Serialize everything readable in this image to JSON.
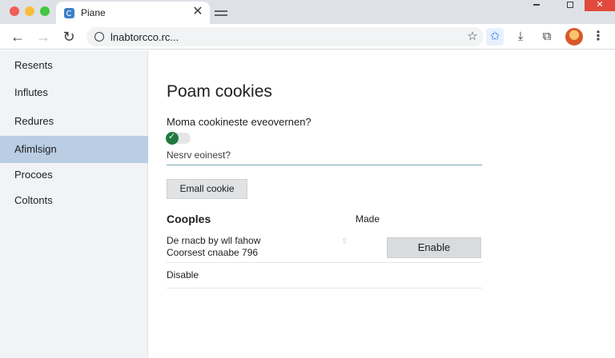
{
  "window": {
    "tab_title": "Piane",
    "tab_close_glyph": "✕",
    "close_glyph": "✕"
  },
  "toolbar": {
    "url": "lnabtorcco.rc..."
  },
  "sidebar": {
    "items": [
      {
        "label": "Resents",
        "active": false
      },
      {
        "label": "Influtes",
        "active": false
      },
      {
        "label": "Redures",
        "active": false
      },
      {
        "label": "Afimlsign",
        "active": true
      },
      {
        "label": "Procoes",
        "active": false
      },
      {
        "label": "Coltonts",
        "active": false
      }
    ]
  },
  "main": {
    "title": "Poam cookies",
    "setting_label": "Moma cookineste eveovernen?",
    "toggle_on": true,
    "input_placeholder": "Nesrv eoinest?",
    "email_button": "Emall cookie",
    "section_title": "Cooples",
    "column_header": "Made",
    "row_line1": "De rnacb by wll fahow",
    "row_line2": "Coorsest cnaabe 796",
    "enable_button": "Enable",
    "disable_link": "Disable"
  },
  "colors": {
    "active_sidebar": "#b9cde3",
    "toggle_green": "#1e7b3d",
    "accent_blue": "#1a73e8"
  }
}
